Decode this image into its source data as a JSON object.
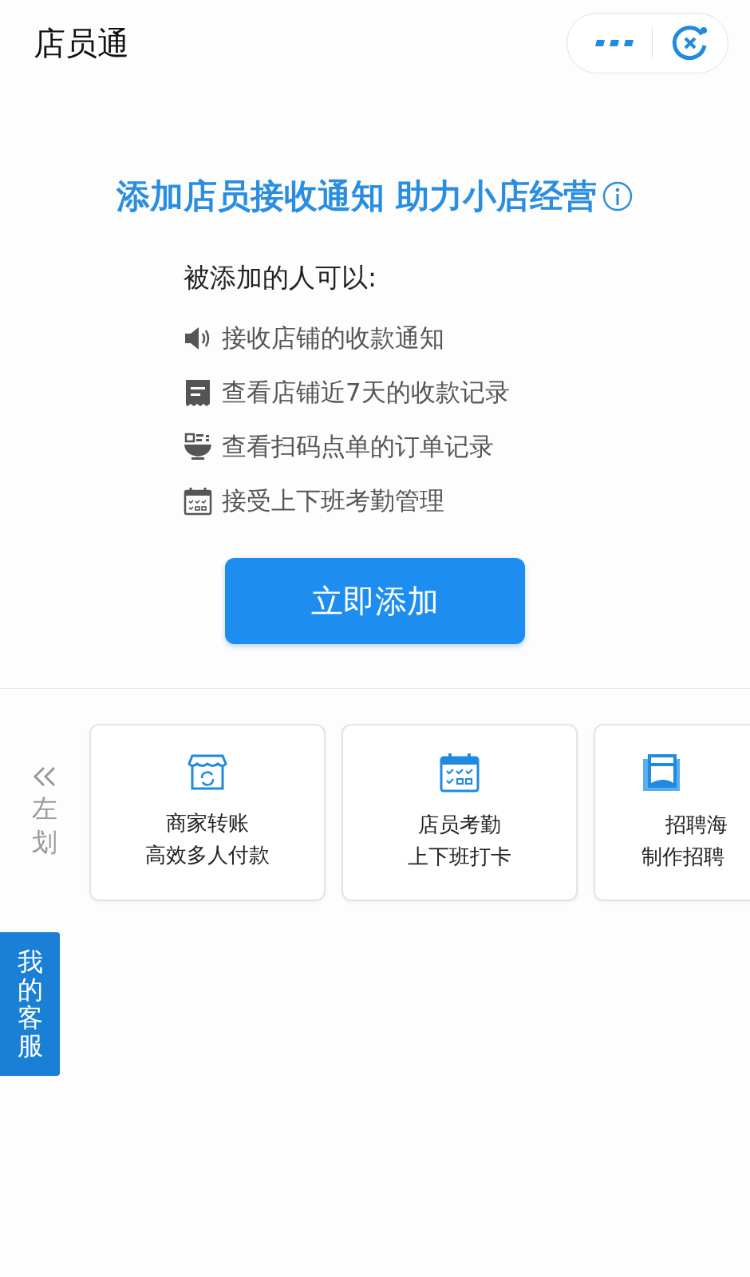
{
  "nav": {
    "title": "店员通"
  },
  "headline": "添加店员接收通知 助力小店经营",
  "intro": "被添加的人可以:",
  "features": [
    "接收店铺的收款通知",
    "查看店铺近7天的收款记录",
    "查看扫码点单的订单记录",
    "接受上下班考勤管理"
  ],
  "add_button": "立即添加",
  "swipe_hint": "左划",
  "cards": [
    {
      "title": "商家转账",
      "subtitle": "高效多人付款"
    },
    {
      "title": "店员考勤",
      "subtitle": "上下班打卡"
    },
    {
      "title": "招聘海",
      "subtitle": "制作招聘"
    }
  ],
  "service_tab": "我的客服"
}
